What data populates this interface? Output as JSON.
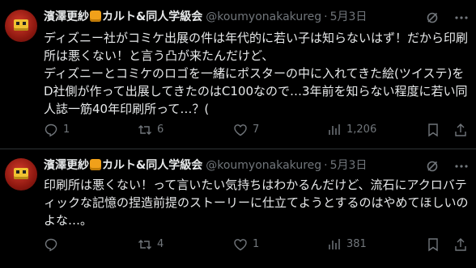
{
  "posts": [
    {
      "author": {
        "name": "濱澤更紗",
        "name_suffix": "カルト&同人学級会",
        "handle": "@koumyonakakureg",
        "separator": "·",
        "date": "5月3日"
      },
      "text": "ディズニー社がコミケ出展の件は年代的に若い子は知らないはず！だから印刷所は悪くない！と言う凸が来たんだけど、\nディズニーとコミケのロゴを一緒にポスターの中に入れてきた絵(ツイステ)をD社側が作って出展してきたのはC100なので…3年前を知らない程度に若い同人誌一筋40年印刷所って…？(",
      "stats": {
        "replies": "1",
        "reposts": "6",
        "likes": "7",
        "views": "1,206"
      }
    },
    {
      "author": {
        "name": "濱澤更紗",
        "name_suffix": "カルト&同人学級会",
        "handle": "@koumyonakakureg",
        "separator": "·",
        "date": "5月3日"
      },
      "text": "印刷所は悪くない！って言いたい気持ちはわかるんだけど、流石にアクロバティックな記憶の捏造前提のストーリーに仕立てようとするのはやめてほしいのよな…。",
      "stats": {
        "replies": "",
        "reposts": "4",
        "likes": "1",
        "views": "381"
      }
    }
  ],
  "icons": {
    "reply": "reply-icon",
    "repost": "repost-icon",
    "like": "heart-icon",
    "views": "views-icon",
    "bookmark": "bookmark-icon",
    "share": "share-icon",
    "grok": "grok-icon",
    "more": "more-icon"
  },
  "colors": {
    "background": "#000000",
    "text": "#e7e9ea",
    "muted": "#71767b",
    "divider": "#2f3336"
  }
}
